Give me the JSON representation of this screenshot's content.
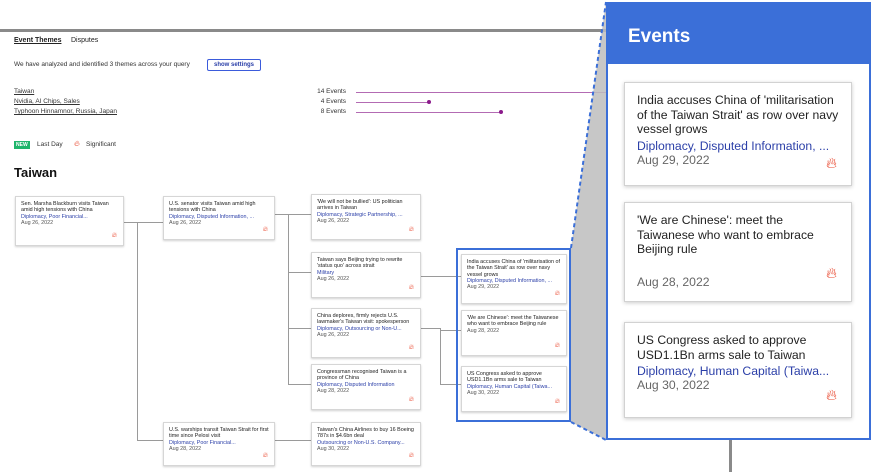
{
  "tabs": [
    {
      "label": "Event Themes",
      "active": true
    },
    {
      "label": "Disputes",
      "active": false
    }
  ],
  "intro": {
    "text": "We have analyzed and identified 3 themes across your query",
    "button_label": "show settings"
  },
  "themes": [
    {
      "name": "Taiwan",
      "count": "14 Events",
      "fraction": 1.0
    },
    {
      "name": "Nvidia, AI Chips, Sales",
      "count": "4 Events",
      "fraction": 0.29
    },
    {
      "name": "Typhoon Hinnamnor, Russia, Japan",
      "count": "8 Events",
      "fraction": 0.57
    }
  ],
  "legend": {
    "new_badge": "NEW",
    "last_day": "Last Day",
    "significant": "Significant",
    "flame_icon": "flame-icon"
  },
  "section": {
    "title": "Taiwan"
  },
  "events": [
    {
      "title": "Sen. Marsha Blackburn visits Taiwan amid high tensions with China",
      "tags": "Diplomacy, Poor Financial...",
      "date": "Aug 26, 2022"
    },
    {
      "title": "U.S. senator visits Taiwan amid high tensions with China",
      "tags": "Diplomacy, Disputed Information, ...",
      "date": "Aug 26, 2022"
    },
    {
      "title": "'We will not be bullied': US politician arrives in Taiwan",
      "tags": "Diplomacy, Strategic Partnership, ...",
      "date": "Aug 26, 2022"
    },
    {
      "title": "Taiwan says Beijing trying to rewrite 'status quo' across strait",
      "tags": "Military",
      "date": "Aug 26, 2022"
    },
    {
      "title": "China deplores, firmly rejects U.S. lawmaker's Taiwan visit: spokesperson",
      "tags": "Diplomacy, Outsourcing or Non-U...",
      "date": "Aug 26, 2022"
    },
    {
      "title": "Congressman recognised Taiwan is a province of China",
      "tags": "Diplomacy, Disputed Information",
      "date": "Aug 28, 2022"
    },
    {
      "title": "India accuses China of 'militarisation of the Taiwan Strait' as row over navy vessel grows",
      "tags": "Diplomacy, Disputed Information, ...",
      "date": "Aug 29, 2022"
    },
    {
      "title": "'We are Chinese': meet the Taiwanese who want to embrace Beijing rule",
      "tags": "",
      "date": "Aug 28, 2022"
    },
    {
      "title": "US Congress asked to approve USD1.1Bn arms sale to Taiwan",
      "tags": "Diplomacy, Human Capital (Taiwa...",
      "date": "Aug 30, 2022"
    },
    {
      "title": "U.S. warships transit Taiwan Strait for first time since Pelosi visit",
      "tags": "Diplomacy, Poor Financial...",
      "date": "Aug 28, 2022"
    },
    {
      "title": "Taiwan's China Airlines to buy 16 Boeing 787s in $4.6bn deal",
      "tags": "Outsourcing or Non-U.S. Company...",
      "date": "Aug 30, 2022"
    }
  ],
  "zoom_panel": {
    "title": "Events",
    "cards": [
      {
        "title": "India accuses China of 'militarisation of the Taiwan Strait' as row over navy vessel grows",
        "tags": "Diplomacy, Disputed Information, ...",
        "date": "Aug 29, 2022"
      },
      {
        "title": "'We are Chinese': meet the Taiwanese who want to embrace Beijing rule",
        "tags": "",
        "date": "Aug 28, 2022"
      },
      {
        "title": "US Congress asked to approve USD1.1Bn arms sale to Taiwan",
        "tags": "Diplomacy, Human Capital (Taiwa...",
        "date": "Aug 30, 2022"
      }
    ]
  },
  "colors": {
    "accent": "#3b6fd8",
    "link": "#2b3fa8",
    "flame": "#e8452c",
    "new_badge": "#1fb56b",
    "bar": "#8b1a8b"
  }
}
